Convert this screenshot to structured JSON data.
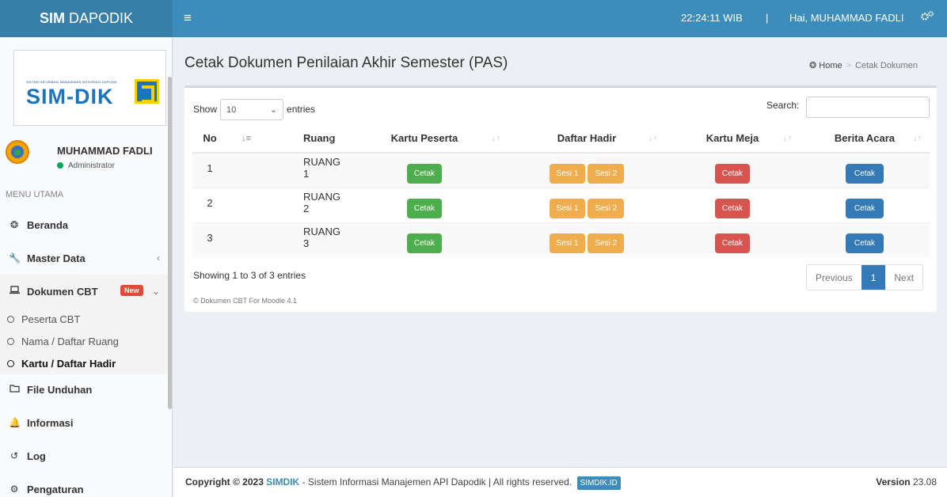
{
  "topbar": {
    "logo_bold": "SIM",
    "logo_rest": "DAPODIK",
    "menu_icon": "≡",
    "clock": "22:24:11 WIB",
    "separator": "|",
    "greeting": "Hai, MUHAMMAD FADLI"
  },
  "sidebar": {
    "brand_tagline": "SISTEM INFORMASI MANAJEMEN INTEGRASI DAPODIK",
    "brand_name": "SIM-DIK",
    "user_name": "MUHAMMAD FADLI",
    "user_role": "Administrator",
    "menu_header": "MENU UTAMA",
    "items": {
      "beranda": "Beranda",
      "master": "Master Data",
      "dokumen": "Dokumen CBT",
      "dokumen_badge": "New",
      "file": "File Unduhan",
      "informasi": "Informasi",
      "log": "Log",
      "pengaturan": "Pengaturan"
    },
    "subitems": [
      "Peserta CBT",
      "Nama / Daftar Ruang",
      "Kartu / Daftar Hadir"
    ]
  },
  "page": {
    "title": "Cetak Dokumen Penilaian Akhir Semester (PAS)",
    "breadcrumb_home": "Home",
    "breadcrumb_sep": ">",
    "breadcrumb_current": "Cetak Dokumen"
  },
  "table_controls": {
    "show": "Show",
    "entries_value": "10",
    "entries": "entries",
    "search": "Search:",
    "search_value": ""
  },
  "table": {
    "headers": [
      "No",
      "Ruang",
      "Kartu Peserta",
      "Daftar Hadir",
      "Kartu Meja",
      "Berita Acara"
    ],
    "rows": [
      {
        "no": "1",
        "ruang": "RUANG 1"
      },
      {
        "no": "2",
        "ruang": "RUANG 2"
      },
      {
        "no": "3",
        "ruang": "RUANG 3"
      }
    ],
    "btn_cetak": "Cetak",
    "btn_sesi1": "Sesi 1",
    "btn_sesi2": "Sesi 2"
  },
  "table_footer": {
    "info": "Showing 1 to 3 of 3 entries",
    "note": "© Dokumen CBT For Moodle 4.1",
    "prev": "Previous",
    "page": "1",
    "next": "Next"
  },
  "footer": {
    "copyright": "Copyright © 2023",
    "brand": "SIMDIK",
    "text": "- Sistem Informasi Manajemen API Dapodik | All rights reserved.",
    "tag": "SIMDIK.ID",
    "version_label": "Version",
    "version": "23.08"
  },
  "colors": {
    "header": "#3c8dbc",
    "logo_bg": "#367fa9",
    "green": "#4cae4c",
    "orange": "#f0ad4e",
    "red": "#d9534f",
    "blue": "#337ab7",
    "badge": "#dd4b39"
  }
}
